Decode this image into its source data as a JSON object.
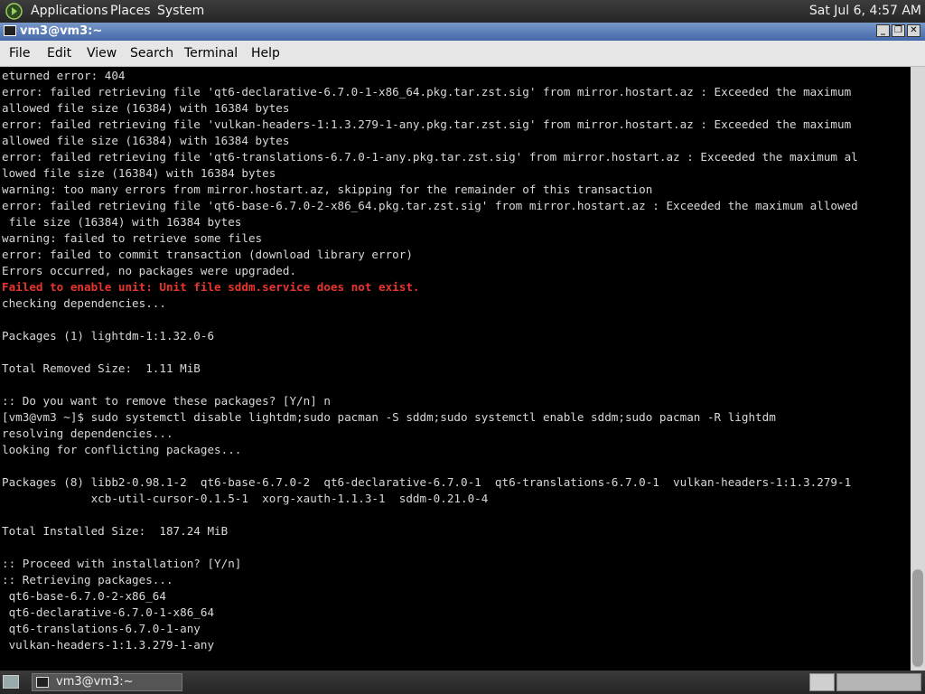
{
  "top_panel": {
    "menus": [
      "Applications",
      "Places",
      "System"
    ],
    "clock": "Sat Jul  6,  4:57 AM"
  },
  "window": {
    "title": "vm3@vm3:~",
    "controls": [
      "_",
      "❐",
      "✕"
    ]
  },
  "menubar": [
    "File",
    "Edit",
    "View",
    "Search",
    "Terminal",
    "Help"
  ],
  "terminal": {
    "lines": [
      "eturned error: 404",
      "error: failed retrieving file 'qt6-declarative-6.7.0-1-x86_64.pkg.tar.zst.sig' from mirror.hostart.az : Exceeded the maximum",
      "allowed file size (16384) with 16384 bytes",
      "error: failed retrieving file 'vulkan-headers-1:1.3.279-1-any.pkg.tar.zst.sig' from mirror.hostart.az : Exceeded the maximum",
      "allowed file size (16384) with 16384 bytes",
      "error: failed retrieving file 'qt6-translations-6.7.0-1-any.pkg.tar.zst.sig' from mirror.hostart.az : Exceeded the maximum al",
      "lowed file size (16384) with 16384 bytes",
      "warning: too many errors from mirror.hostart.az, skipping for the remainder of this transaction",
      "error: failed retrieving file 'qt6-base-6.7.0-2-x86_64.pkg.tar.zst.sig' from mirror.hostart.az : Exceeded the maximum allowed",
      " file size (16384) with 16384 bytes",
      "warning: failed to retrieve some files",
      "error: failed to commit transaction (download library error)",
      "Errors occurred, no packages were upgraded.",
      "Failed to enable unit: Unit file sddm.service does not exist.",
      "checking dependencies...",
      "",
      "Packages (1) lightdm-1:1.32.0-6",
      "",
      "Total Removed Size:  1.11 MiB",
      "",
      ":: Do you want to remove these packages? [Y/n] n",
      "[vm3@vm3 ~]$ sudo systemctl disable lightdm;sudo pacman -S sddm;sudo systemctl enable sddm;sudo pacman -R lightdm",
      "resolving dependencies...",
      "looking for conflicting packages...",
      "",
      "Packages (8) libb2-0.98.1-2  qt6-base-6.7.0-2  qt6-declarative-6.7.0-1  qt6-translations-6.7.0-1  vulkan-headers-1:1.3.279-1",
      "             xcb-util-cursor-0.1.5-1  xorg-xauth-1.1.3-1  sddm-0.21.0-4",
      "",
      "Total Installed Size:  187.24 MiB",
      "",
      ":: Proceed with installation? [Y/n]",
      ":: Retrieving packages...",
      " qt6-base-6.7.0-2-x86_64",
      " qt6-declarative-6.7.0-1-x86_64",
      " qt6-translations-6.7.0-1-any",
      " vulkan-headers-1:1.3.279-1-any"
    ],
    "error_line_index": 13,
    "error_color": "#e8352e",
    "text_color": "#d8d8d8",
    "background": "#000000"
  },
  "taskbar": {
    "task_label": "vm3@vm3:~"
  }
}
